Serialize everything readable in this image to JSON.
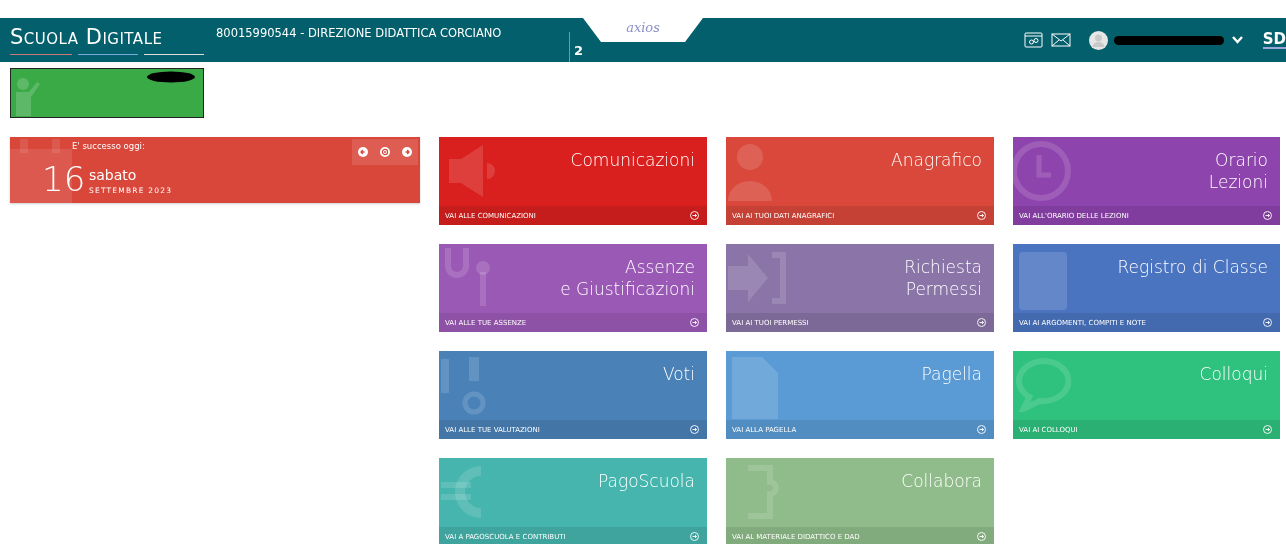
{
  "header": {
    "logo": "Scuola Digitale",
    "school": "80015990544 - DIREZIONE DIDATTICA CORCIANO",
    "partial_text": "2",
    "brand": "axios",
    "user_initials": "SD"
  },
  "today": {
    "heading": "E' successo oggi:",
    "day": "16",
    "weekday": "sabato",
    "month_year": "SETTEMBRE 2023"
  },
  "tiles": [
    {
      "title": [
        "Comunicazioni"
      ],
      "link": "VAI ALLE COMUNICAZIONI",
      "color": "#d9201e"
    },
    {
      "title": [
        "Anagrafico"
      ],
      "link": "VAI AI TUOI DATI ANAGRAFICI",
      "color": "#d9483b"
    },
    {
      "title": [
        "Orario",
        "Lezioni"
      ],
      "link": "VAI ALL'ORARIO DELLE LEZIONI",
      "color": "#8e44ad"
    },
    {
      "title": [
        "Assenze",
        "e Giustificazioni"
      ],
      "link": "VAI ALLE TUE ASSENZE",
      "color": "#9b59b6"
    },
    {
      "title": [
        "Richiesta",
        "Permessi"
      ],
      "link": "VAI AI TUOI PERMESSI",
      "color": "#8a74a8"
    },
    {
      "title": [
        "Registro di Classe"
      ],
      "link": "VAI AI ARGOMENTI, COMPITI E NOTE",
      "color": "#4a74c0"
    },
    {
      "title": [
        "Voti"
      ],
      "link": "VAI ALLE TUE VALUTAZIONI",
      "color": "#4a82b8"
    },
    {
      "title": [
        "Pagella"
      ],
      "link": "VAI ALLA PAGELLA",
      "color": "#5b9bd5"
    },
    {
      "title": [
        "Colloqui"
      ],
      "link": "VAI AI COLLOQUI",
      "color": "#2ec27e"
    },
    {
      "title": [
        "PagoScuola"
      ],
      "link": "VAI A PAGOSCUOLA E CONTRIBUTI",
      "color": "#45b5ad"
    },
    {
      "title": [
        "Collabora"
      ],
      "link": "VAI AL MATERIALE DIDATTICO E DAD",
      "color": "#8fbc8a"
    }
  ]
}
